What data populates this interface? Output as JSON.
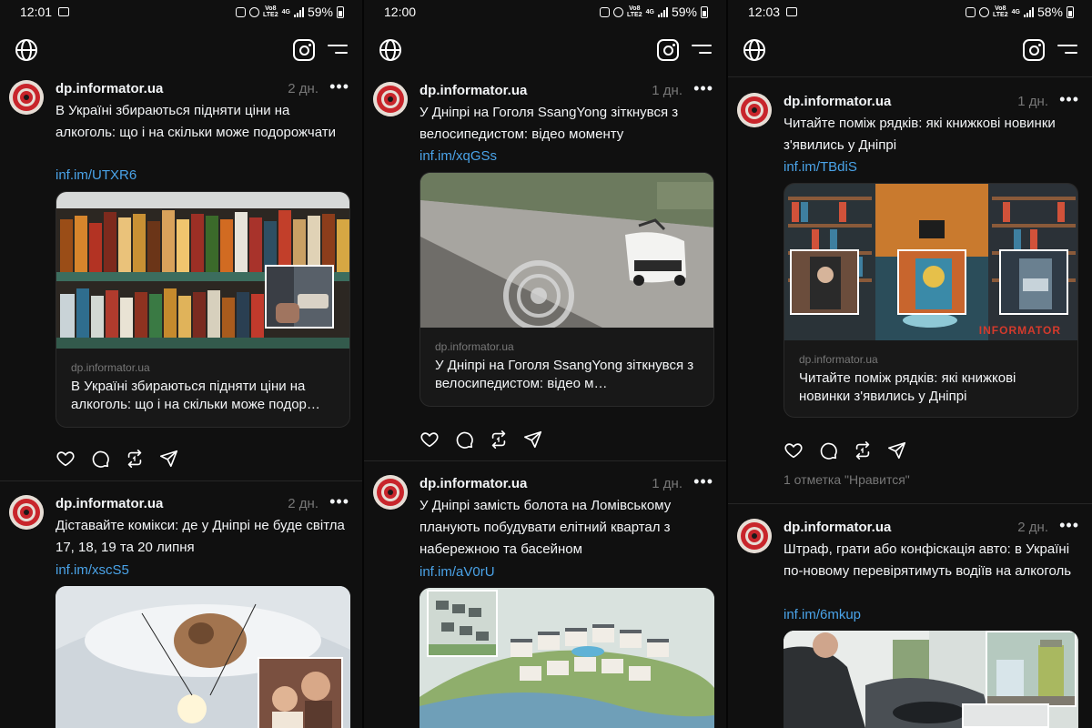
{
  "panels": [
    {
      "status": {
        "time": "12:01",
        "battery": "59%",
        "net": "Vo8\nLTE2",
        "gen": "4G"
      },
      "posts": [
        {
          "author": "dp.informator.ua",
          "time": "2 дн.",
          "text": "В Україні збираються підняти ціни на алкоголь: що і на скільки може подорожчати",
          "link": "inf.im/UTXR6",
          "card_domain": "dp.informator.ua",
          "card_title": "В Україні збираються підняти ціни на алкоголь: що і на скільки може подор…"
        },
        {
          "author": "dp.informator.ua",
          "time": "2 дн.",
          "text": "Діставайте комікси: де у Дніпрі не буде світла 17, 18, 19 та 20 липня",
          "link": "inf.im/xscS5"
        }
      ]
    },
    {
      "status": {
        "time": "12:00",
        "battery": "59%",
        "net": "Vo8\nLTE2",
        "gen": "4G"
      },
      "posts": [
        {
          "author": "dp.informator.ua",
          "time": "1 дн.",
          "text": "У Дніпрі на Гоголя SsangYong зіткнувся з велосипедистом: відео моменту",
          "link": "inf.im/xqGSs",
          "card_domain": "dp.informator.ua",
          "card_title": "У Дніпрі на Гоголя SsangYong зіткнувся з велосипедистом: відео м…"
        },
        {
          "author": "dp.informator.ua",
          "time": "1 дн.",
          "text": "У Дніпрі замість болота на Ломівському планують побудувати елітний квартал з набережною та басейном",
          "link": "inf.im/aV0rU"
        }
      ]
    },
    {
      "status": {
        "time": "12:03",
        "battery": "58%",
        "net": "Vo8\nLTE2",
        "gen": "4G"
      },
      "posts": [
        {
          "author": "dp.informator.ua",
          "time": "1 дн.",
          "text": "Читайте поміж рядків: які книжкові новинки з'явились у Дніпрі",
          "link": "inf.im/TBdiS",
          "card_domain": "dp.informator.ua",
          "card_title": "Читайте поміж рядків: які книжкові новинки з'явились у Дніпрі",
          "likes": "1 отметка \"Нравится\"",
          "watermark": "INFORMATOR"
        },
        {
          "author": "dp.informator.ua",
          "time": "2 дн.",
          "text": "Штраф, грати або конфіскація авто: в Україні по-новому перевірятимуть водіїв на алкоголь",
          "link": "inf.im/6mkup"
        }
      ]
    }
  ],
  "colors": {
    "background": "#101010",
    "link": "#4aa3e8",
    "muted": "#777777",
    "brand_red": "#c8252b"
  },
  "icons": [
    "globe-icon",
    "instagram-icon",
    "menu-icon",
    "like-icon",
    "comment-icon",
    "repost-icon",
    "share-icon",
    "more-icon"
  ]
}
